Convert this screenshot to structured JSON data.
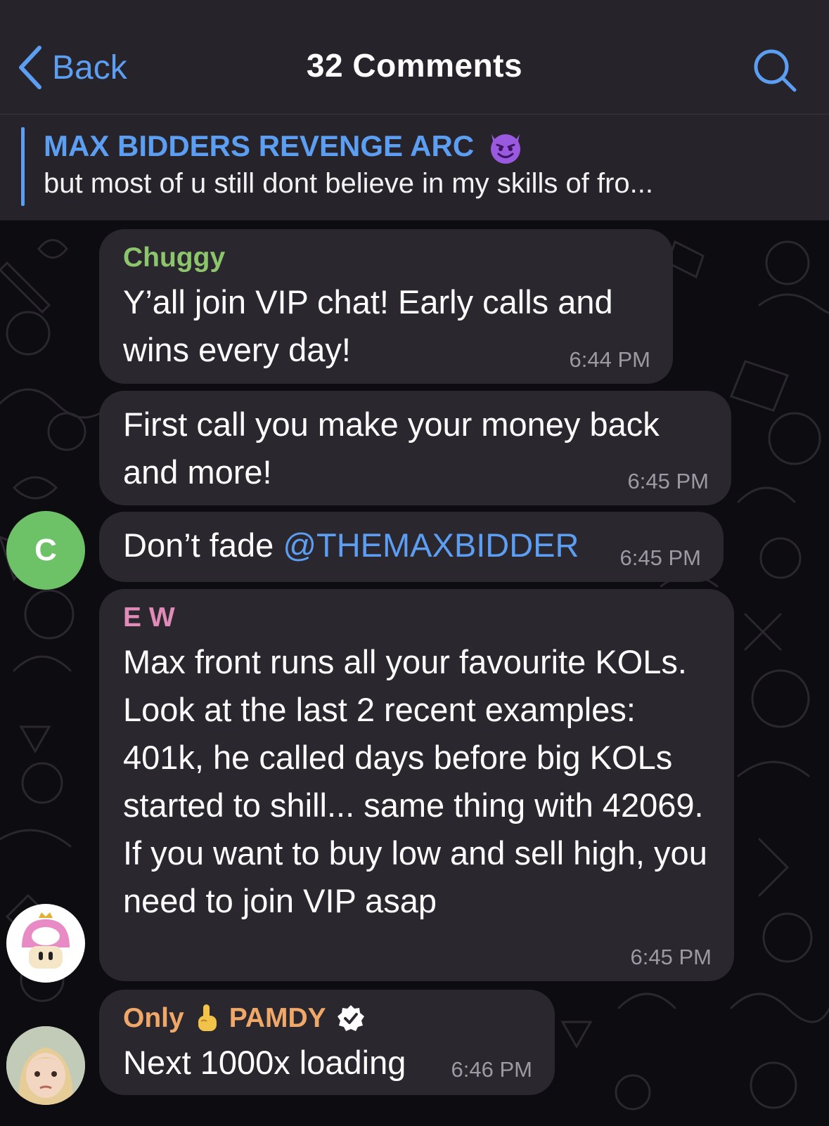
{
  "header": {
    "back_label": "Back",
    "title": "32 Comments",
    "accent": "#5c9ef2"
  },
  "pinned": {
    "title": "MAX BIDDERS REVENGE ARC",
    "title_emoji": "smiling-devil-icon",
    "text": "but most of u still dont believe in my skills of fro..."
  },
  "messages": [
    {
      "sender": "Chuggy",
      "sender_color": "#8cc56c",
      "text": "Y’all join VIP chat! Early calls and wins every day!",
      "time": "6:44 PM"
    },
    {
      "text": "First call you make your money back and more!",
      "time": "6:45 PM"
    },
    {
      "text_before": "Don’t fade ",
      "mention": "@THEMAXBIDDER",
      "time": "6:45 PM",
      "avatar_letter": "C",
      "avatar_color": "#6dc167"
    },
    {
      "sender": "E W",
      "sender_color": "#e08bb8",
      "text": "Max front runs all your favourite KOLs. Look at the last 2 recent examples: 401k, he called days before big KOLs started to shill... same thing with 42069. If you want to buy low and sell high, you need to join VIP asap",
      "time": "6:45 PM",
      "avatar": "mushroom-avatar-icon"
    },
    {
      "sender_prefix": "Only",
      "sender_suffix": "PAMDY",
      "sender_color": "#f0a868",
      "sender_emoji": "pointing-up-hand-icon",
      "verified": "verified-badge-icon",
      "text": "Next 1000x loading",
      "time": "6:46 PM",
      "avatar": "child-photo-avatar"
    }
  ]
}
